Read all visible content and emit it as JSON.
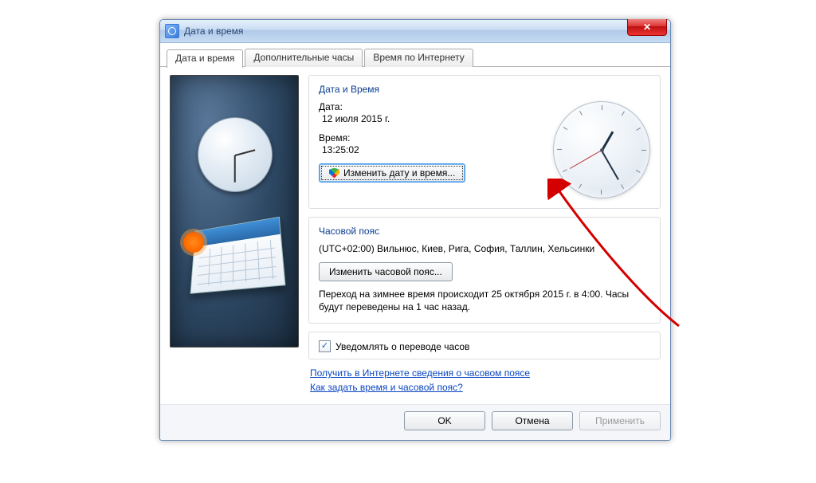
{
  "window": {
    "title": "Дата и время"
  },
  "tabs": {
    "t0": "Дата и время",
    "t1": "Дополнительные часы",
    "t2": "Время по Интернету"
  },
  "datetime_group": {
    "title": "Дата и Время",
    "date_label": "Дата:",
    "date_value": "12 июля 2015 г.",
    "time_label": "Время:",
    "time_value": "13:25:02",
    "change_btn": "Изменить дату и время..."
  },
  "timezone_group": {
    "title": "Часовой пояс",
    "tz_value": "(UTC+02:00) Вильнюс, Киев, Рига, София, Таллин, Хельсинки",
    "change_btn": "Изменить часовой пояс...",
    "dst_note": "Переход на зимнее время происходит 25 октября 2015 г. в 4:00. Часы будут переведены на 1 час назад.",
    "notify_label": "Уведомлять о переводе часов"
  },
  "links": {
    "l1": "Получить в Интернете сведения о часовом поясе",
    "l2": "Как задать время и часовой пояс?"
  },
  "footer": {
    "ok": "OK",
    "cancel": "Отмена",
    "apply": "Применить"
  }
}
